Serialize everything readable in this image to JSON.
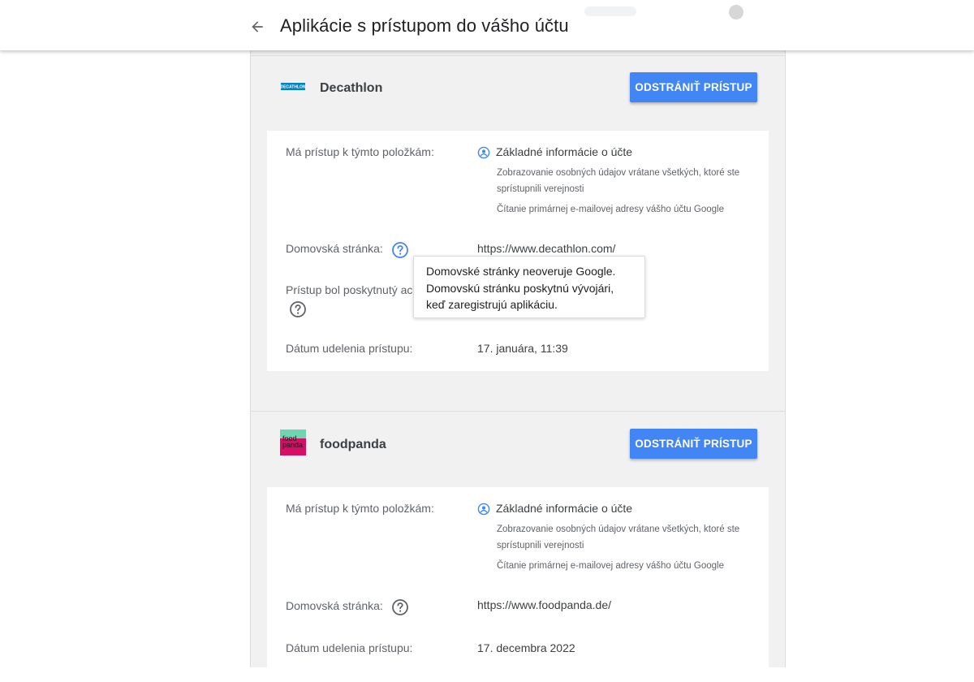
{
  "header": {
    "title": "Aplikácie s prístupom do vášho účtu",
    "back_icon": "arrow-back-icon"
  },
  "colors": {
    "accent": "#4285f4",
    "page_bg": "#f1f1f1",
    "card_bg": "#ffffff",
    "foodpanda_pink": "#d70f64",
    "foodpanda_mint": "#6dd6b0",
    "decathlon_blue": "#0082c3"
  },
  "apps": [
    {
      "name": "Decathlon",
      "logo_icon": "decathlon-logo",
      "logo_text": "DECATHLON",
      "remove_label": "ODSTRÁNIŤ PRÍSTUP",
      "access_label": "Má prístup k týmto položkám:",
      "permission": {
        "icon": "account-circle-icon",
        "title": "Základné informácie o účte",
        "description": "Zobrazovanie osobných údajov vrátane všetkých, ktoré ste sprístupnili verejnosti",
        "email": "Čítanie primárnej e-mailovej adresy vášho účtu Google"
      },
      "homepage_label": "Domovská stránka:",
      "homepage_url": "https://www.decathlon.com/",
      "granted_to_label": "Prístup bol poskytnutý ac",
      "date_label": "Dátum udelenia prístupu:",
      "date_value": "17. januára, 11:39"
    },
    {
      "name": "foodpanda",
      "logo_icon": "foodpanda-logo",
      "logo_text_1": "food",
      "logo_text_2": "panda",
      "remove_label": "ODSTRÁNIŤ PRÍSTUP",
      "access_label": "Má prístup k týmto položkám:",
      "permission": {
        "icon": "account-circle-icon",
        "title": "Základné informácie o účte",
        "description": "Zobrazovanie osobných údajov vrátane všetkých, ktoré ste sprístupnili verejnosti",
        "email": "Čítanie primárnej e-mailovej adresy vášho účtu Google"
      },
      "homepage_label": "Domovská stránka:",
      "homepage_url": "https://www.foodpanda.de/",
      "date_label": "Dátum udelenia prístupu:",
      "date_value": "17. decembra 2022"
    }
  ],
  "tooltip": {
    "line1": "Domovské stránky neoveruje Google.",
    "line2": "Domovskú stránku poskytnú vývojári,",
    "line3": "keď zaregistrujú aplikáciu."
  }
}
